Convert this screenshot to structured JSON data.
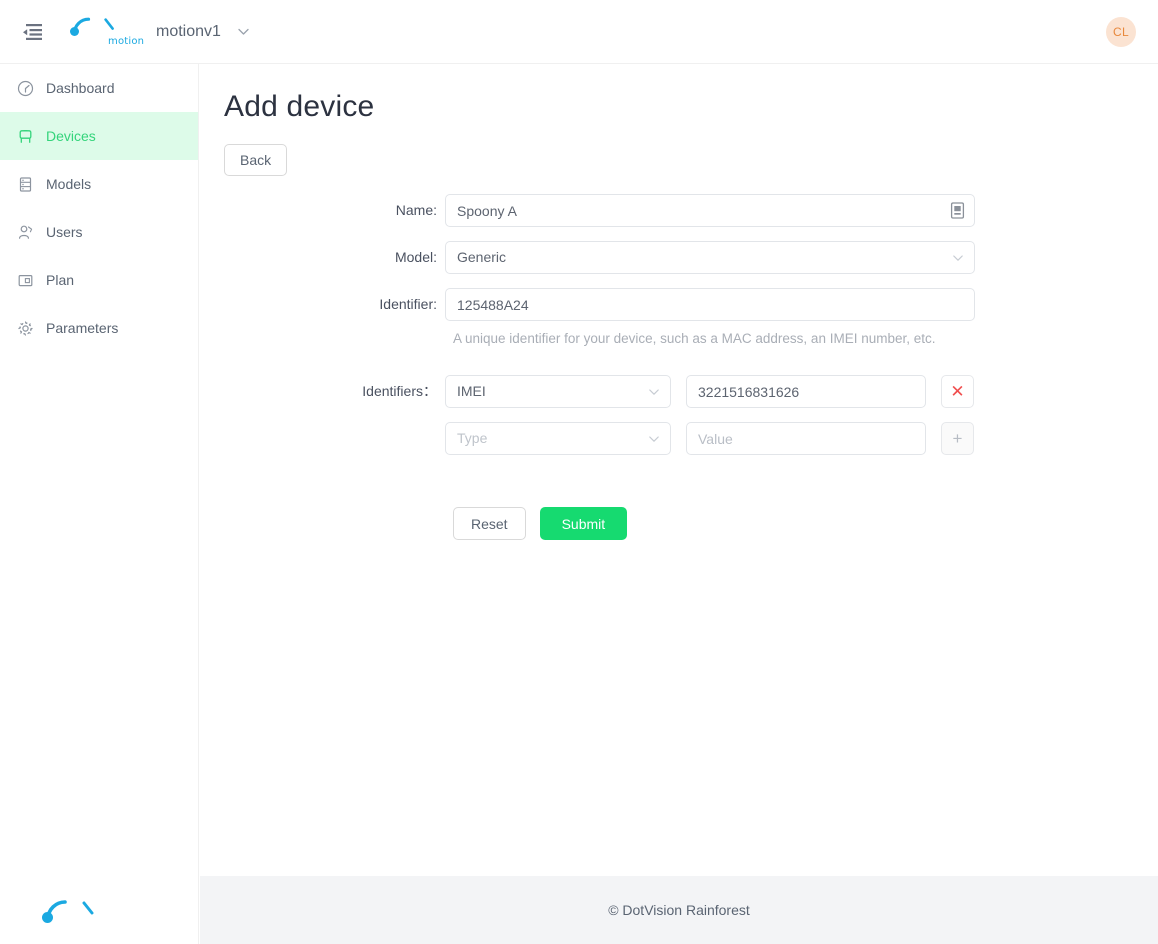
{
  "header": {
    "menu_icon": "menu-fold-icon",
    "logo_word": "motion",
    "org_name": "motionv1",
    "org_caret_icon": "chevron-down-icon",
    "avatar_initials": "CL"
  },
  "sidebar": {
    "items": [
      {
        "label": "Dashboard",
        "icon": "dashboard-gauge-icon",
        "active": false
      },
      {
        "label": "Devices",
        "icon": "device-icon",
        "active": true
      },
      {
        "label": "Models",
        "icon": "server-models-icon",
        "active": false
      },
      {
        "label": "Users",
        "icon": "user-group-icon",
        "active": false
      },
      {
        "label": "Plan",
        "icon": "plan-card-icon",
        "active": false
      },
      {
        "label": "Parameters",
        "icon": "gear-icon",
        "active": false
      }
    ],
    "active_color": "#34d47b",
    "active_background": "#ddfbe9"
  },
  "main": {
    "page_title": "Add device",
    "back_label": "Back",
    "form": {
      "name": {
        "label": "Name:",
        "value": "Spoony A",
        "placeholder": "",
        "suffix_icon": "device-picker-icon"
      },
      "model": {
        "label": "Model:",
        "value": "Generic",
        "caret_icon": "chevron-down-icon"
      },
      "identifier": {
        "label": "Identifier:",
        "value": "125488A24",
        "placeholder": "",
        "helper": "A unique identifier for your device, such as a MAC address, an IMEI number, etc."
      },
      "identifiers": {
        "label": "Identifiers：",
        "rows": [
          {
            "type_value": "IMEI",
            "type_placeholder": "Type",
            "value": "3221516831626",
            "value_placeholder": "Value",
            "action_icon": "close-x-icon",
            "action_label": "✕"
          },
          {
            "type_value": "",
            "type_placeholder": "Type",
            "value": "",
            "value_placeholder": "Value",
            "action_icon": "plus-icon",
            "action_label": "+"
          }
        ]
      },
      "reset_label": "Reset",
      "submit_label": "Submit",
      "submit_color": "#16da70"
    }
  },
  "footer": {
    "copyright": "© DotVision Rainforest"
  }
}
